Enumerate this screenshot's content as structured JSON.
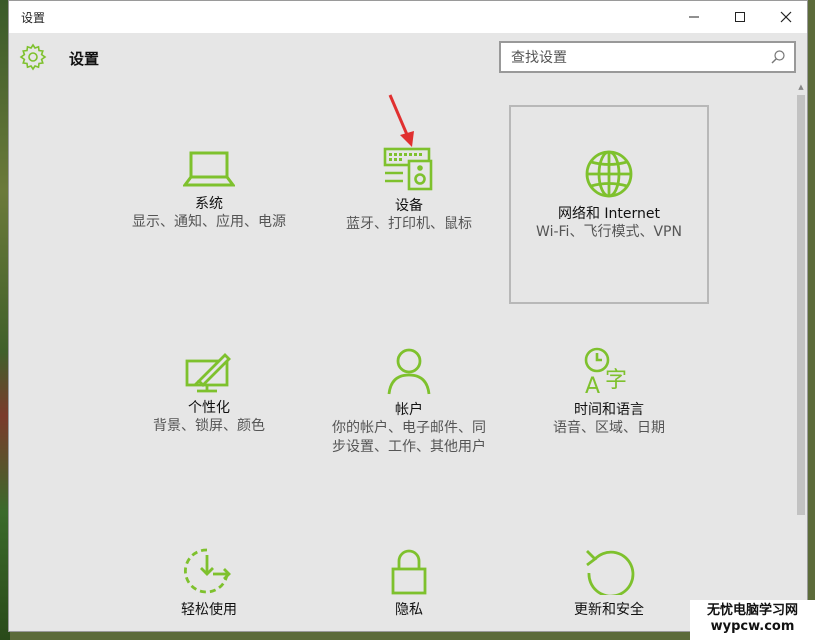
{
  "window": {
    "title": "设置"
  },
  "header": {
    "app_title": "设置",
    "search_placeholder": "查找设置"
  },
  "accent_color": "#7ec12d",
  "tiles": [
    {
      "name": "系统",
      "desc": "显示、通知、应用、电源",
      "icon": "laptop-icon"
    },
    {
      "name": "设备",
      "desc": "蓝牙、打印机、鼠标",
      "icon": "devices-icon"
    },
    {
      "name": "网络和 Internet",
      "desc": "Wi-Fi、飞行模式、VPN",
      "icon": "globe-icon"
    },
    {
      "name": "个性化",
      "desc": "背景、锁屏、颜色",
      "icon": "personalization-icon"
    },
    {
      "name": "帐户",
      "desc": "你的帐户、电子邮件、同步设置、工作、其他用户",
      "icon": "person-icon"
    },
    {
      "name": "时间和语言",
      "desc": "语音、区域、日期",
      "icon": "time-language-icon"
    },
    {
      "name": "轻松使用",
      "desc": "",
      "icon": "ease-of-access-icon"
    },
    {
      "name": "隐私",
      "desc": "",
      "icon": "lock-icon"
    },
    {
      "name": "更新和安全",
      "desc": "",
      "icon": "update-icon"
    }
  ],
  "watermark": {
    "line1": "无忧电脑学习网",
    "line2": "wypcw.com"
  }
}
